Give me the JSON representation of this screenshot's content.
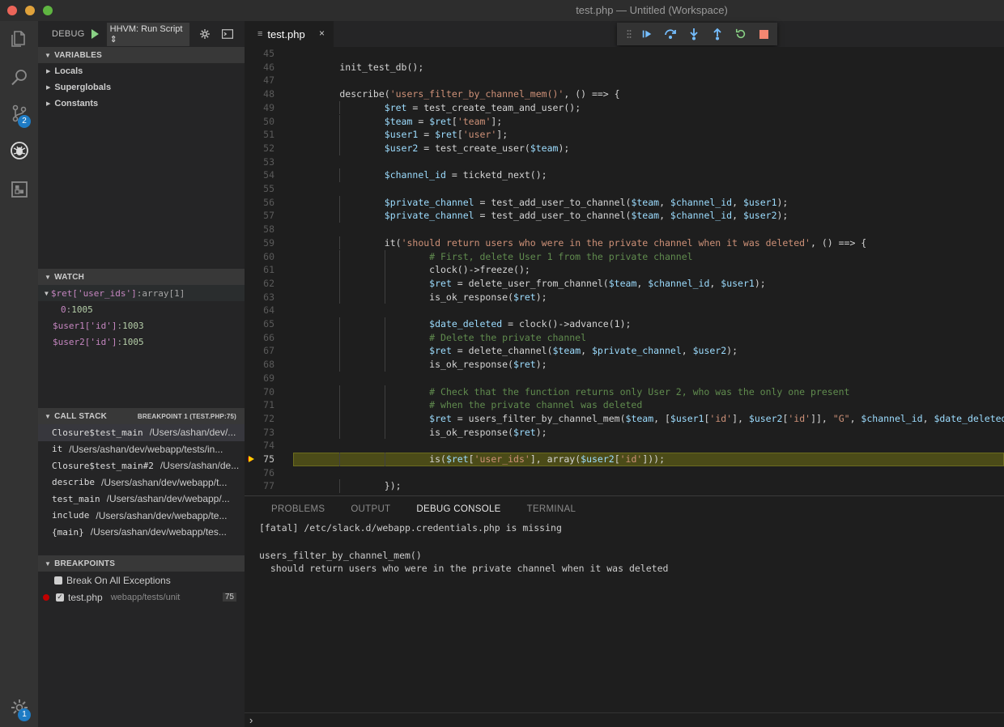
{
  "window": {
    "title": "test.php — Untitled (Workspace)"
  },
  "activity_bar": {
    "source_control_badge": "2",
    "settings_badge": "1"
  },
  "debug_toolbar": {
    "label": "DEBUG",
    "config": "HHVM: Run Script",
    "config_arrow": "⇕"
  },
  "variables": {
    "header": "VARIABLES",
    "items": [
      "Locals",
      "Superglobals",
      "Constants"
    ]
  },
  "watch": {
    "header": "WATCH",
    "items": [
      {
        "expr": "$ret['user_ids']",
        "sep": ": ",
        "value": "array[1]",
        "child_key": "0",
        "child_sep": ": ",
        "child_value": "1005"
      },
      {
        "expr": "$user1['id']",
        "sep": ": ",
        "value": "1003"
      },
      {
        "expr": "$user2['id']",
        "sep": ": ",
        "value": "1005"
      }
    ]
  },
  "call_stack": {
    "header": "CALL STACK",
    "status": "BREAKPOINT 1 (TEST.PHP:75)",
    "frames": [
      {
        "name": "Closure$test_main",
        "path": "/Users/ashan/dev/..."
      },
      {
        "name": "it",
        "path": "/Users/ashan/dev/webapp/tests/in..."
      },
      {
        "name": "Closure$test_main#2",
        "path": "/Users/ashan/de..."
      },
      {
        "name": "describe",
        "path": "/Users/ashan/dev/webapp/t..."
      },
      {
        "name": "test_main",
        "path": "/Users/ashan/dev/webapp/..."
      },
      {
        "name": "include",
        "path": "/Users/ashan/dev/webapp/te..."
      },
      {
        "name": "{main}",
        "path": "/Users/ashan/dev/webapp/tes..."
      }
    ]
  },
  "breakpoints": {
    "header": "BREAKPOINTS",
    "exceptions_label": "Break On All Exceptions",
    "file": "test.php",
    "folder": "webapp/tests/unit",
    "line": "75"
  },
  "editor": {
    "tab": "test.php",
    "tab_close": "×",
    "current_line": 75,
    "lines": [
      {
        "n": "45",
        "t": ""
      },
      {
        "n": "46",
        "t": "        init_test_db();"
      },
      {
        "n": "47",
        "t": ""
      },
      {
        "n": "48",
        "t": "        describe('users_filter_by_channel_mem()', () ==> {"
      },
      {
        "n": "49",
        "t": "                $ret = test_create_team_and_user();"
      },
      {
        "n": "50",
        "t": "                $team = $ret['team'];"
      },
      {
        "n": "51",
        "t": "                $user1 = $ret['user'];"
      },
      {
        "n": "52",
        "t": "                $user2 = test_create_user($team);"
      },
      {
        "n": "53",
        "t": ""
      },
      {
        "n": "54",
        "t": "                $channel_id = ticketd_next();"
      },
      {
        "n": "55",
        "t": ""
      },
      {
        "n": "56",
        "t": "                $private_channel = test_add_user_to_channel($team, $channel_id, $user1);"
      },
      {
        "n": "57",
        "t": "                $private_channel = test_add_user_to_channel($team, $channel_id, $user2);"
      },
      {
        "n": "58",
        "t": ""
      },
      {
        "n": "59",
        "t": "                it('should return users who were in the private channel when it was deleted', () ==> {"
      },
      {
        "n": "60",
        "t": "                        # First, delete User 1 from the private channel"
      },
      {
        "n": "61",
        "t": "                        clock()->freeze();"
      },
      {
        "n": "62",
        "t": "                        $ret = delete_user_from_channel($team, $channel_id, $user1);"
      },
      {
        "n": "63",
        "t": "                        is_ok_response($ret);"
      },
      {
        "n": "64",
        "t": ""
      },
      {
        "n": "65",
        "t": "                        $date_deleted = clock()->advance(1);"
      },
      {
        "n": "66",
        "t": "                        # Delete the private channel"
      },
      {
        "n": "67",
        "t": "                        $ret = delete_channel($team, $private_channel, $user2);"
      },
      {
        "n": "68",
        "t": "                        is_ok_response($ret);"
      },
      {
        "n": "69",
        "t": ""
      },
      {
        "n": "70",
        "t": "                        # Check that the function returns only User 2, who was the only one present"
      },
      {
        "n": "71",
        "t": "                        # when the private channel was deleted"
      },
      {
        "n": "72",
        "t": "                        $ret = users_filter_by_channel_mem($team, [$user1['id'], $user2['id']], \"G\", $channel_id, $date_deleted);"
      },
      {
        "n": "73",
        "t": "                        is_ok_response($ret);"
      },
      {
        "n": "74",
        "t": ""
      },
      {
        "n": "75",
        "t": "                        is($ret['user_ids'], array($user2['id']));"
      },
      {
        "n": "76",
        "t": ""
      },
      {
        "n": "77",
        "t": "                });"
      }
    ]
  },
  "panel": {
    "tabs": [
      "PROBLEMS",
      "OUTPUT",
      "DEBUG CONSOLE",
      "TERMINAL"
    ],
    "active_tab": "DEBUG CONSOLE",
    "console": [
      "[fatal] /etc/slack.d/webapp.credentials.php is missing",
      "",
      "users_filter_by_channel_mem()",
      "  should return users who were in the private channel when it was deleted"
    ],
    "prompt": "›"
  },
  "colors": {
    "breakpoint": "#c10000",
    "current_line_bg": "#4b4b18",
    "accent_badge": "#1e7bc4"
  },
  "icons": [
    "explorer-icon",
    "search-icon",
    "source-control-icon",
    "debug-icon",
    "extensions-icon",
    "settings-gear-icon"
  ]
}
